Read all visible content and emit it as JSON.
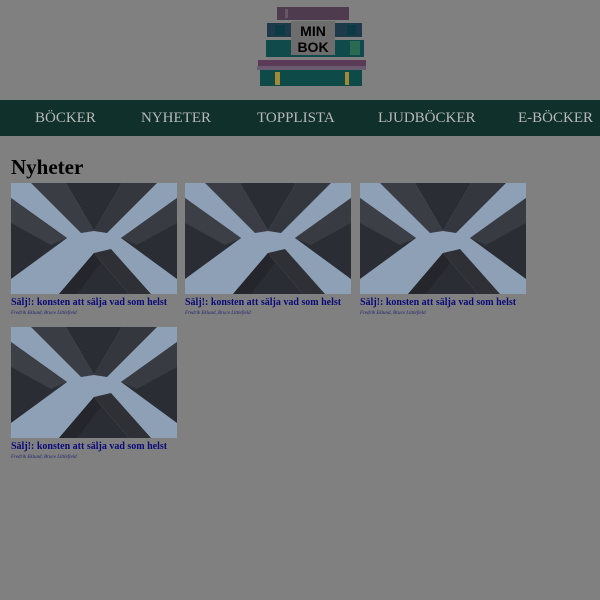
{
  "logo": {
    "line1": "MIN",
    "line2": "BOK"
  },
  "nav": {
    "items": [
      {
        "label": "BÖCKER"
      },
      {
        "label": "NYHETER"
      },
      {
        "label": "TOPPLISTA"
      },
      {
        "label": "LJUDBÖCKER"
      },
      {
        "label": "E-BÖCKER"
      }
    ]
  },
  "section": {
    "title": "Nyheter"
  },
  "books": [
    {
      "title": "Sälj!: konsten att sälja vad som helst",
      "authors": "Fredrik Eklund, Bruce Littlefield"
    },
    {
      "title": "Sälj!: konsten att sälja vad som helst",
      "authors": "Fredrik Eklund, Bruce Littlefield"
    },
    {
      "title": "Sälj!: konsten att sälja vad som helst",
      "authors": "Fredrik Eklund, Bruce Littlefield"
    },
    {
      "title": "Sälj!: konsten att sälja vad som helst",
      "authors": "Fredrik Eklund, Bruce Littlefield"
    }
  ],
  "colors": {
    "page_overlay": "#808080",
    "nav_background": "#0f302b",
    "nav_text": "#b8b8b8",
    "link": "#0a0a7a"
  }
}
